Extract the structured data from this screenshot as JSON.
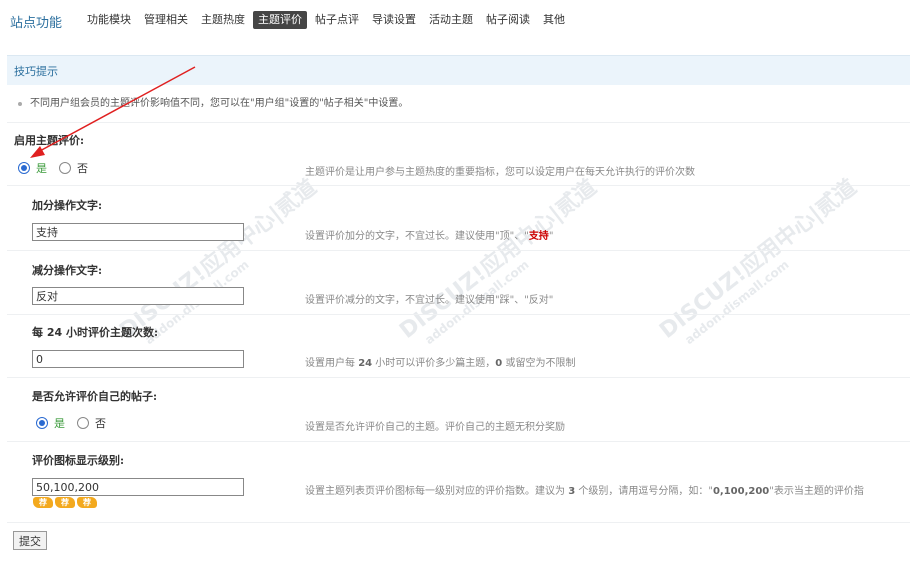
{
  "header": {
    "site_title": "站点功能",
    "nav": [
      {
        "label": "功能模块",
        "active": false
      },
      {
        "label": "管理相关",
        "active": false
      },
      {
        "label": "主题热度",
        "active": false
      },
      {
        "label": "主题评价",
        "active": true
      },
      {
        "label": "帖子点评",
        "active": false
      },
      {
        "label": "导读设置",
        "active": false
      },
      {
        "label": "活动主题",
        "active": false
      },
      {
        "label": "帖子阅读",
        "active": false
      },
      {
        "label": "其他",
        "active": false
      }
    ]
  },
  "tips": {
    "title": "技巧提示",
    "text": "不同用户组会员的主题评价影响值不同，您可以在\"用户组\"设置的\"帖子相关\"中设置。"
  },
  "form": {
    "enable": {
      "label": "启用主题评价:",
      "yes": "是",
      "no": "否",
      "selected": "yes",
      "desc": "主题评价是让用户参与主题热度的重要指标，您可以设定用户在每天允许执行的评价次数"
    },
    "plus_text": {
      "label": "加分操作文字:",
      "value": "支持",
      "desc_prefix": "设置评价加分的文字，不宜过长。建议使用\"顶\"、\"",
      "desc_highlight": "支持",
      "desc_suffix": "\""
    },
    "minus_text": {
      "label": "减分操作文字:",
      "value": "反对",
      "desc": "设置评价减分的文字，不宜过长。建议使用\"踩\"、\"反对\""
    },
    "daily_count": {
      "label_pre": "每",
      "label_num": "24",
      "label_post": "小时评价主题次数:",
      "value": "0",
      "desc_pre": "设置用户每",
      "desc_num": "24",
      "desc_mid": "小时可以评价多少篇主题，",
      "desc_zero": "0",
      "desc_post": "或留空为不限制"
    },
    "self_rate": {
      "label": "是否允许评价自己的帖子:",
      "yes": "是",
      "no": "否",
      "selected": "yes",
      "desc": "设置是否允许评价自己的主题。评价自己的主题无积分奖励"
    },
    "icon_levels": {
      "label": "评价图标显示级别:",
      "value": "50,100,200",
      "desc_pre": "设置主题列表页评价图标每一级别对应的评价指数。建议为",
      "desc_num": "3",
      "desc_mid": "个级别，请用逗号分隔，如：\"",
      "desc_example": "0,100,200",
      "desc_post": "\"表示当主题的评价指",
      "star_icons": [
        "荐",
        "荐",
        "荐"
      ],
      "star_color": "#f3a91e"
    },
    "submit_label": "提交"
  },
  "watermark": {
    "brand": "DISCUZ!应用中心|贰道",
    "domain": "addon.dismall.com"
  },
  "colors": {
    "accent": "#2b6f9e",
    "active_tab_bg": "#454545",
    "tips_bg": "#ebf4fb",
    "yes_text": "#3a9a3a",
    "highlight": "#cc0000",
    "annotation_arrow": "#e02020"
  }
}
